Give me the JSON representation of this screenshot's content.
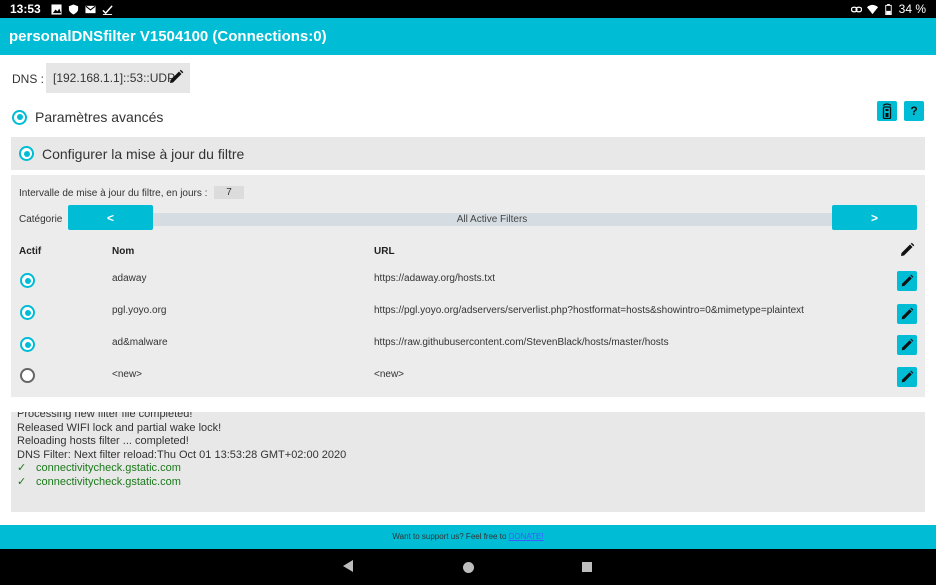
{
  "status_bar": {
    "time": "13:53",
    "battery": "34 %",
    "icons": [
      "image-icon",
      "shield-icon",
      "mail-icon",
      "check-icon",
      "link-icon",
      "wifi-icon",
      "battery-icon"
    ]
  },
  "title": "personalDNSfilter V1504100 (Connections:0)",
  "dns": {
    "label": "DNS :",
    "value": "[192.168.1.1]::53::UDP"
  },
  "advanced": {
    "label": "Paramètres avancés",
    "remote_icon": "remote-icon",
    "help_label": "?"
  },
  "configure": {
    "label": "Configurer la mise à jour du filtre"
  },
  "filter": {
    "interval_label": "Intervalle de mise à jour du filtre, en jours :",
    "interval_value": "7",
    "category_label": "Catégorie",
    "category_value": "All Active Filters",
    "prev_label": "<",
    "next_label": ">",
    "headers": {
      "active": "Actif",
      "name": "Nom",
      "url": "URL"
    },
    "rows": [
      {
        "active": true,
        "name": "adaway",
        "url": "https://adaway.org/hosts.txt"
      },
      {
        "active": true,
        "name": "pgl.yoyo.org",
        "url": "https://pgl.yoyo.org/adservers/serverlist.php?hostformat=hosts&showintro=0&mimetype=plaintext"
      },
      {
        "active": true,
        "name": "ad&malware",
        "url": "https://raw.githubusercontent.com/StevenBlack/hosts/master/hosts"
      },
      {
        "active": false,
        "name": "<new>",
        "url": "<new>"
      }
    ]
  },
  "log": {
    "lines": [
      "Processing new filter file completed!",
      "Released WIFI lock and partial wake lock!",
      "Reloading hosts filter ... completed!",
      "DNS Filter: Next filter reload:Thu Oct 01 13:53:28 GMT+02:00 2020"
    ],
    "ok_lines": [
      "connectivitycheck.gstatic.com",
      "connectivitycheck.gstatic.com"
    ],
    "ok_mark": "✓"
  },
  "footer": {
    "text": "Want to support us? Feel free to ",
    "link": "DONATE!"
  },
  "colors": {
    "accent": "#00bcd4",
    "ok": "#1b7a1b"
  }
}
